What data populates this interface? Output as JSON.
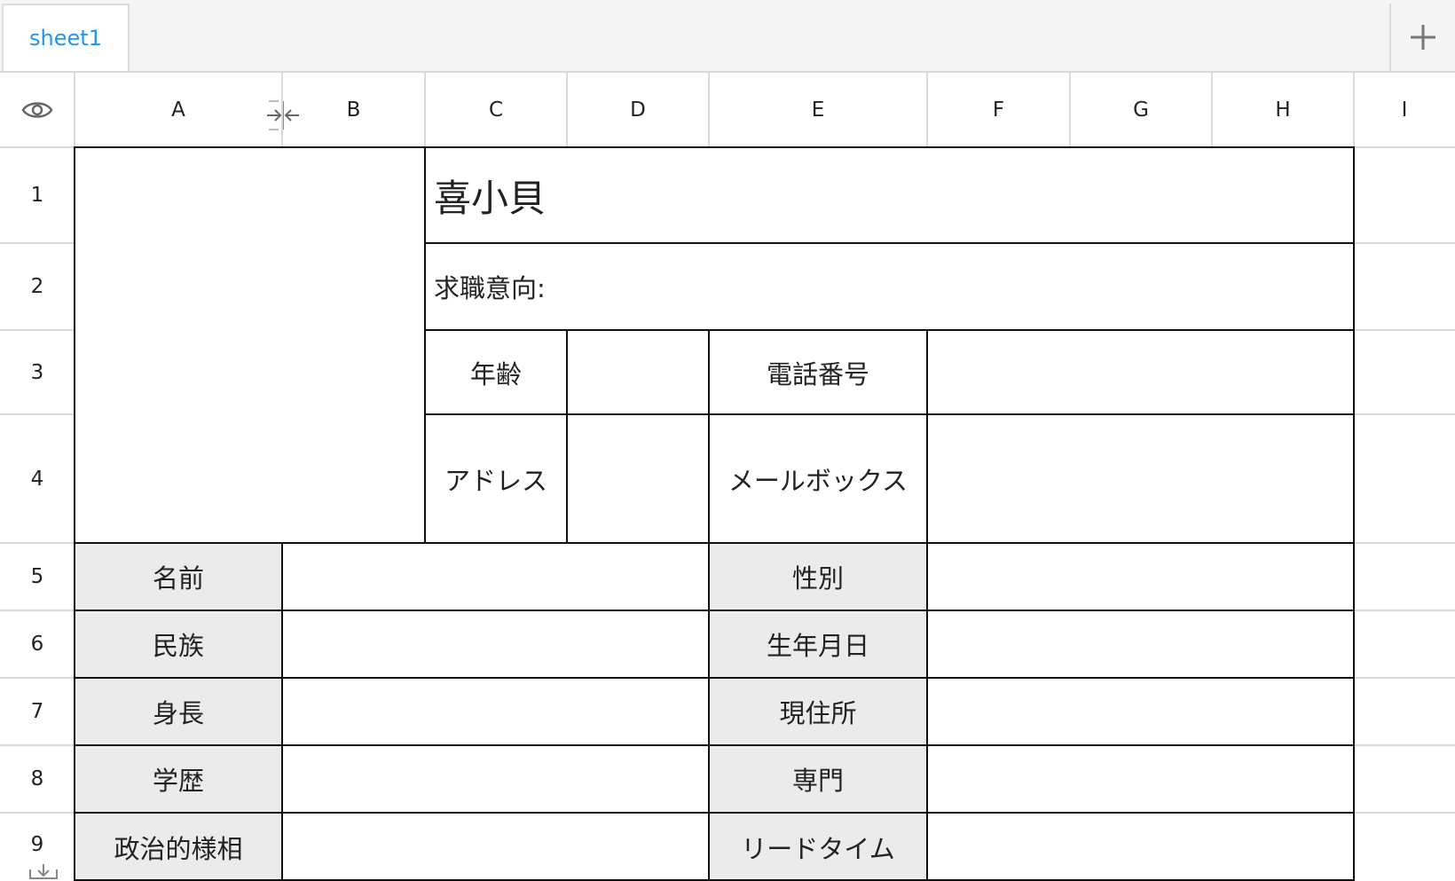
{
  "tabs": [
    {
      "label": "sheet1",
      "active": true
    }
  ],
  "add_sheet_icon": "plus-icon",
  "corner_icon": "eye-icon",
  "resize_icon": "column-resize-icon",
  "row_resize_icon": "download-tray-icon",
  "columns": [
    "A",
    "B",
    "C",
    "D",
    "E",
    "F",
    "G",
    "H",
    "I"
  ],
  "rows": [
    "1",
    "2",
    "3",
    "4",
    "5",
    "6",
    "7",
    "8",
    "9"
  ],
  "resume": {
    "name_title": "喜小貝",
    "job_intent": "求職意向:",
    "age_label": "年齢",
    "phone_label": "電話番号",
    "address_label": "アドレス",
    "mailbox_label": "メールボックス",
    "left_labels": [
      "名前",
      "民族",
      "身長",
      "学歴",
      "政治的様相"
    ],
    "right_labels": [
      "性別",
      "生年月日",
      "現住所",
      "専門",
      "リードタイム"
    ]
  },
  "colors": {
    "accent": "#2196f3",
    "label_fill": "#ebebeb",
    "border": "#111111",
    "gridline": "#d9d9d9"
  }
}
